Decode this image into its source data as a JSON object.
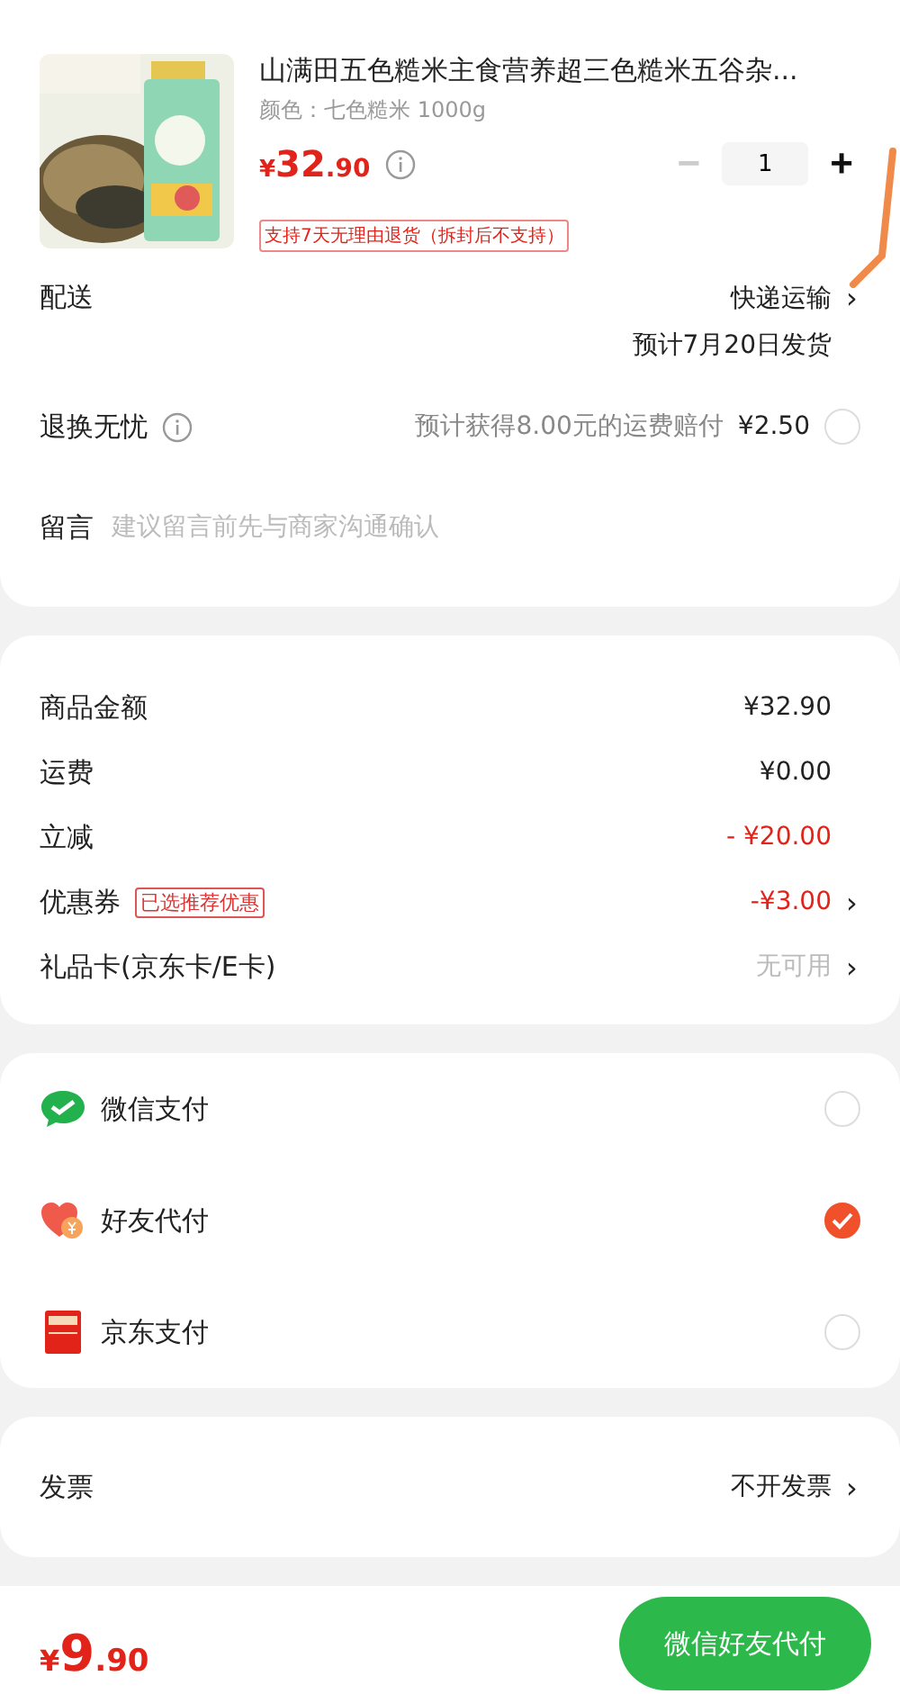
{
  "product": {
    "title": "山满田五色糙米主食营养超三色糙米五谷杂...",
    "variant": "颜色：七色糙米 1000g",
    "price": {
      "symbol": "¥",
      "integer": "32",
      "decimal": ".90"
    },
    "quantity": "1",
    "minus": {
      "label": "−",
      "disabled": true
    },
    "plus": {
      "label": "+",
      "disabled": false
    },
    "return_tag": "支持7天无理由退货（拆封后不支持）"
  },
  "delivery": {
    "label": "配送",
    "method": "快递运输",
    "eta": "预计7月20日发货",
    "chevron": "›"
  },
  "insurance": {
    "label": "退换无忧",
    "note": "预计获得8.00元的运费赔付",
    "price": "¥2.50",
    "checked": false
  },
  "message": {
    "label": "留言",
    "placeholder": "建议留言前先与商家沟通确认"
  },
  "summary": [
    {
      "label": "商品金额",
      "value": "¥32.90",
      "color": "#222222"
    },
    {
      "label": "运费",
      "value": "¥0.00",
      "color": "#222222"
    },
    {
      "label": "立减",
      "value": "- ¥20.00",
      "color": "#e2231a"
    },
    {
      "label": "优惠券",
      "tag": "已选推荐优惠",
      "value": "-¥3.00",
      "color": "#e2231a",
      "chevron": "›"
    },
    {
      "label": "礼品卡(京东卡/E卡)",
      "value": "无可用",
      "color": "#bbbbbb",
      "chevron": "›"
    }
  ],
  "payments": [
    {
      "kind": "wechat",
      "label": "微信支付",
      "selected": false
    },
    {
      "kind": "friend",
      "label": "好友代付",
      "selected": true
    },
    {
      "kind": "jdpay",
      "label": "京东支付",
      "selected": false
    }
  ],
  "invoice": {
    "label": "发票",
    "value": "不开发票",
    "chevron": "›"
  },
  "footer": {
    "price": {
      "symbol": "¥",
      "integer": "9",
      "decimal": ".90"
    },
    "button": "微信好友代付"
  }
}
